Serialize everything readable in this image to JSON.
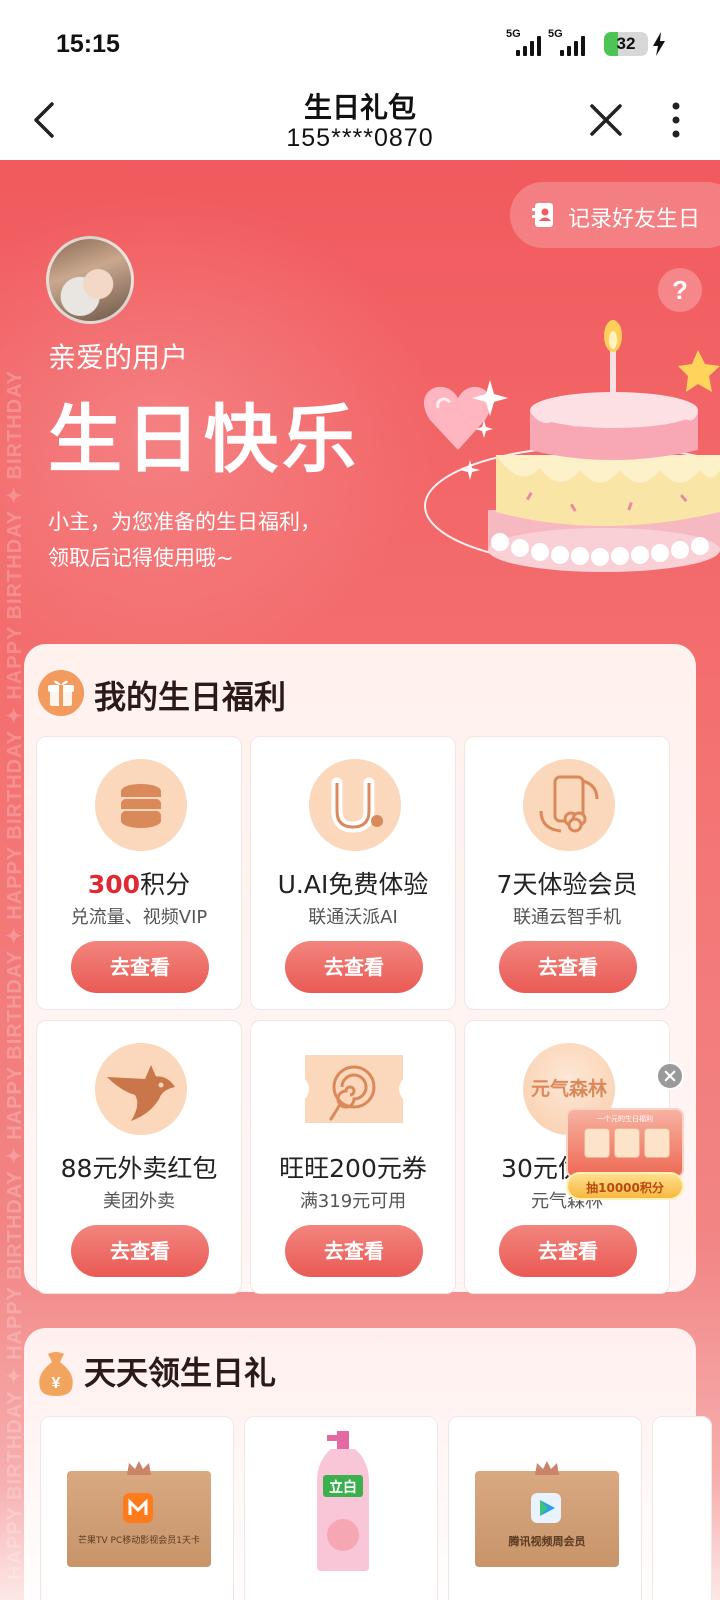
{
  "status_bar": {
    "time": "15:15",
    "sim1": "5G",
    "sim2": "5G",
    "battery": "32",
    "battery_level": 0.32
  },
  "nav": {
    "title": "生日礼包",
    "subtitle": "155****0870"
  },
  "hero": {
    "side_text": "HAPPY BIRTHDAY ✦ HAPPY BIRTHDAY ✦ HAPPY BIRTHDAY ✦ HAPPY BIRTHDAY ✦ HAPPY BIRTHDAY ✦ BIRTHDAY",
    "record_btn": "记录好友生日",
    "help": "?",
    "greeting": "亲爱的用户",
    "title": "生日快乐",
    "desc_line1": "小主，为您准备的生日福利，",
    "desc_line2": "领取后记得使用哦~"
  },
  "benefits": {
    "title": "我的生日福利",
    "items": [
      {
        "highlight": "300",
        "title": "积分",
        "sub": "兑流量、视频VIP",
        "btn": "去查看",
        "icon": "coins-icon"
      },
      {
        "highlight": "",
        "title": "U.AI免费体验",
        "sub": "联通沃派AI",
        "btn": "去查看",
        "icon": "u-ai-icon"
      },
      {
        "highlight": "",
        "title": "7天体验会员",
        "sub": "联通云智手机",
        "btn": "去查看",
        "icon": "cloud-phone-icon"
      },
      {
        "highlight": "",
        "title": "88元外卖红包",
        "sub": "美团外卖",
        "btn": "去查看",
        "icon": "kangaroo-icon"
      },
      {
        "highlight": "",
        "title": "旺旺200元券",
        "sub": "满319元可用",
        "btn": "去查看",
        "icon": "lollipop-ticket-icon"
      },
      {
        "highlight": "",
        "title": "30元优惠券",
        "sub": "元气森林",
        "btn": "去查看",
        "icon": "genki-forest-icon"
      }
    ],
    "genki_logo_text": "元气森林"
  },
  "floating_promo": {
    "top_text": "一个元的生日福利",
    "pill": "抽10000积分"
  },
  "daily": {
    "title": "天天领生日礼",
    "products": [
      {
        "caption": "芒果TV PC移动影视会员1天卡"
      },
      {
        "brand": "立白"
      },
      {
        "caption": "腾讯视频周会员"
      }
    ]
  },
  "colors": {
    "hero_red": "#f15a5e",
    "button_red": "#ea5a55",
    "highlight_red": "#e02a33"
  }
}
